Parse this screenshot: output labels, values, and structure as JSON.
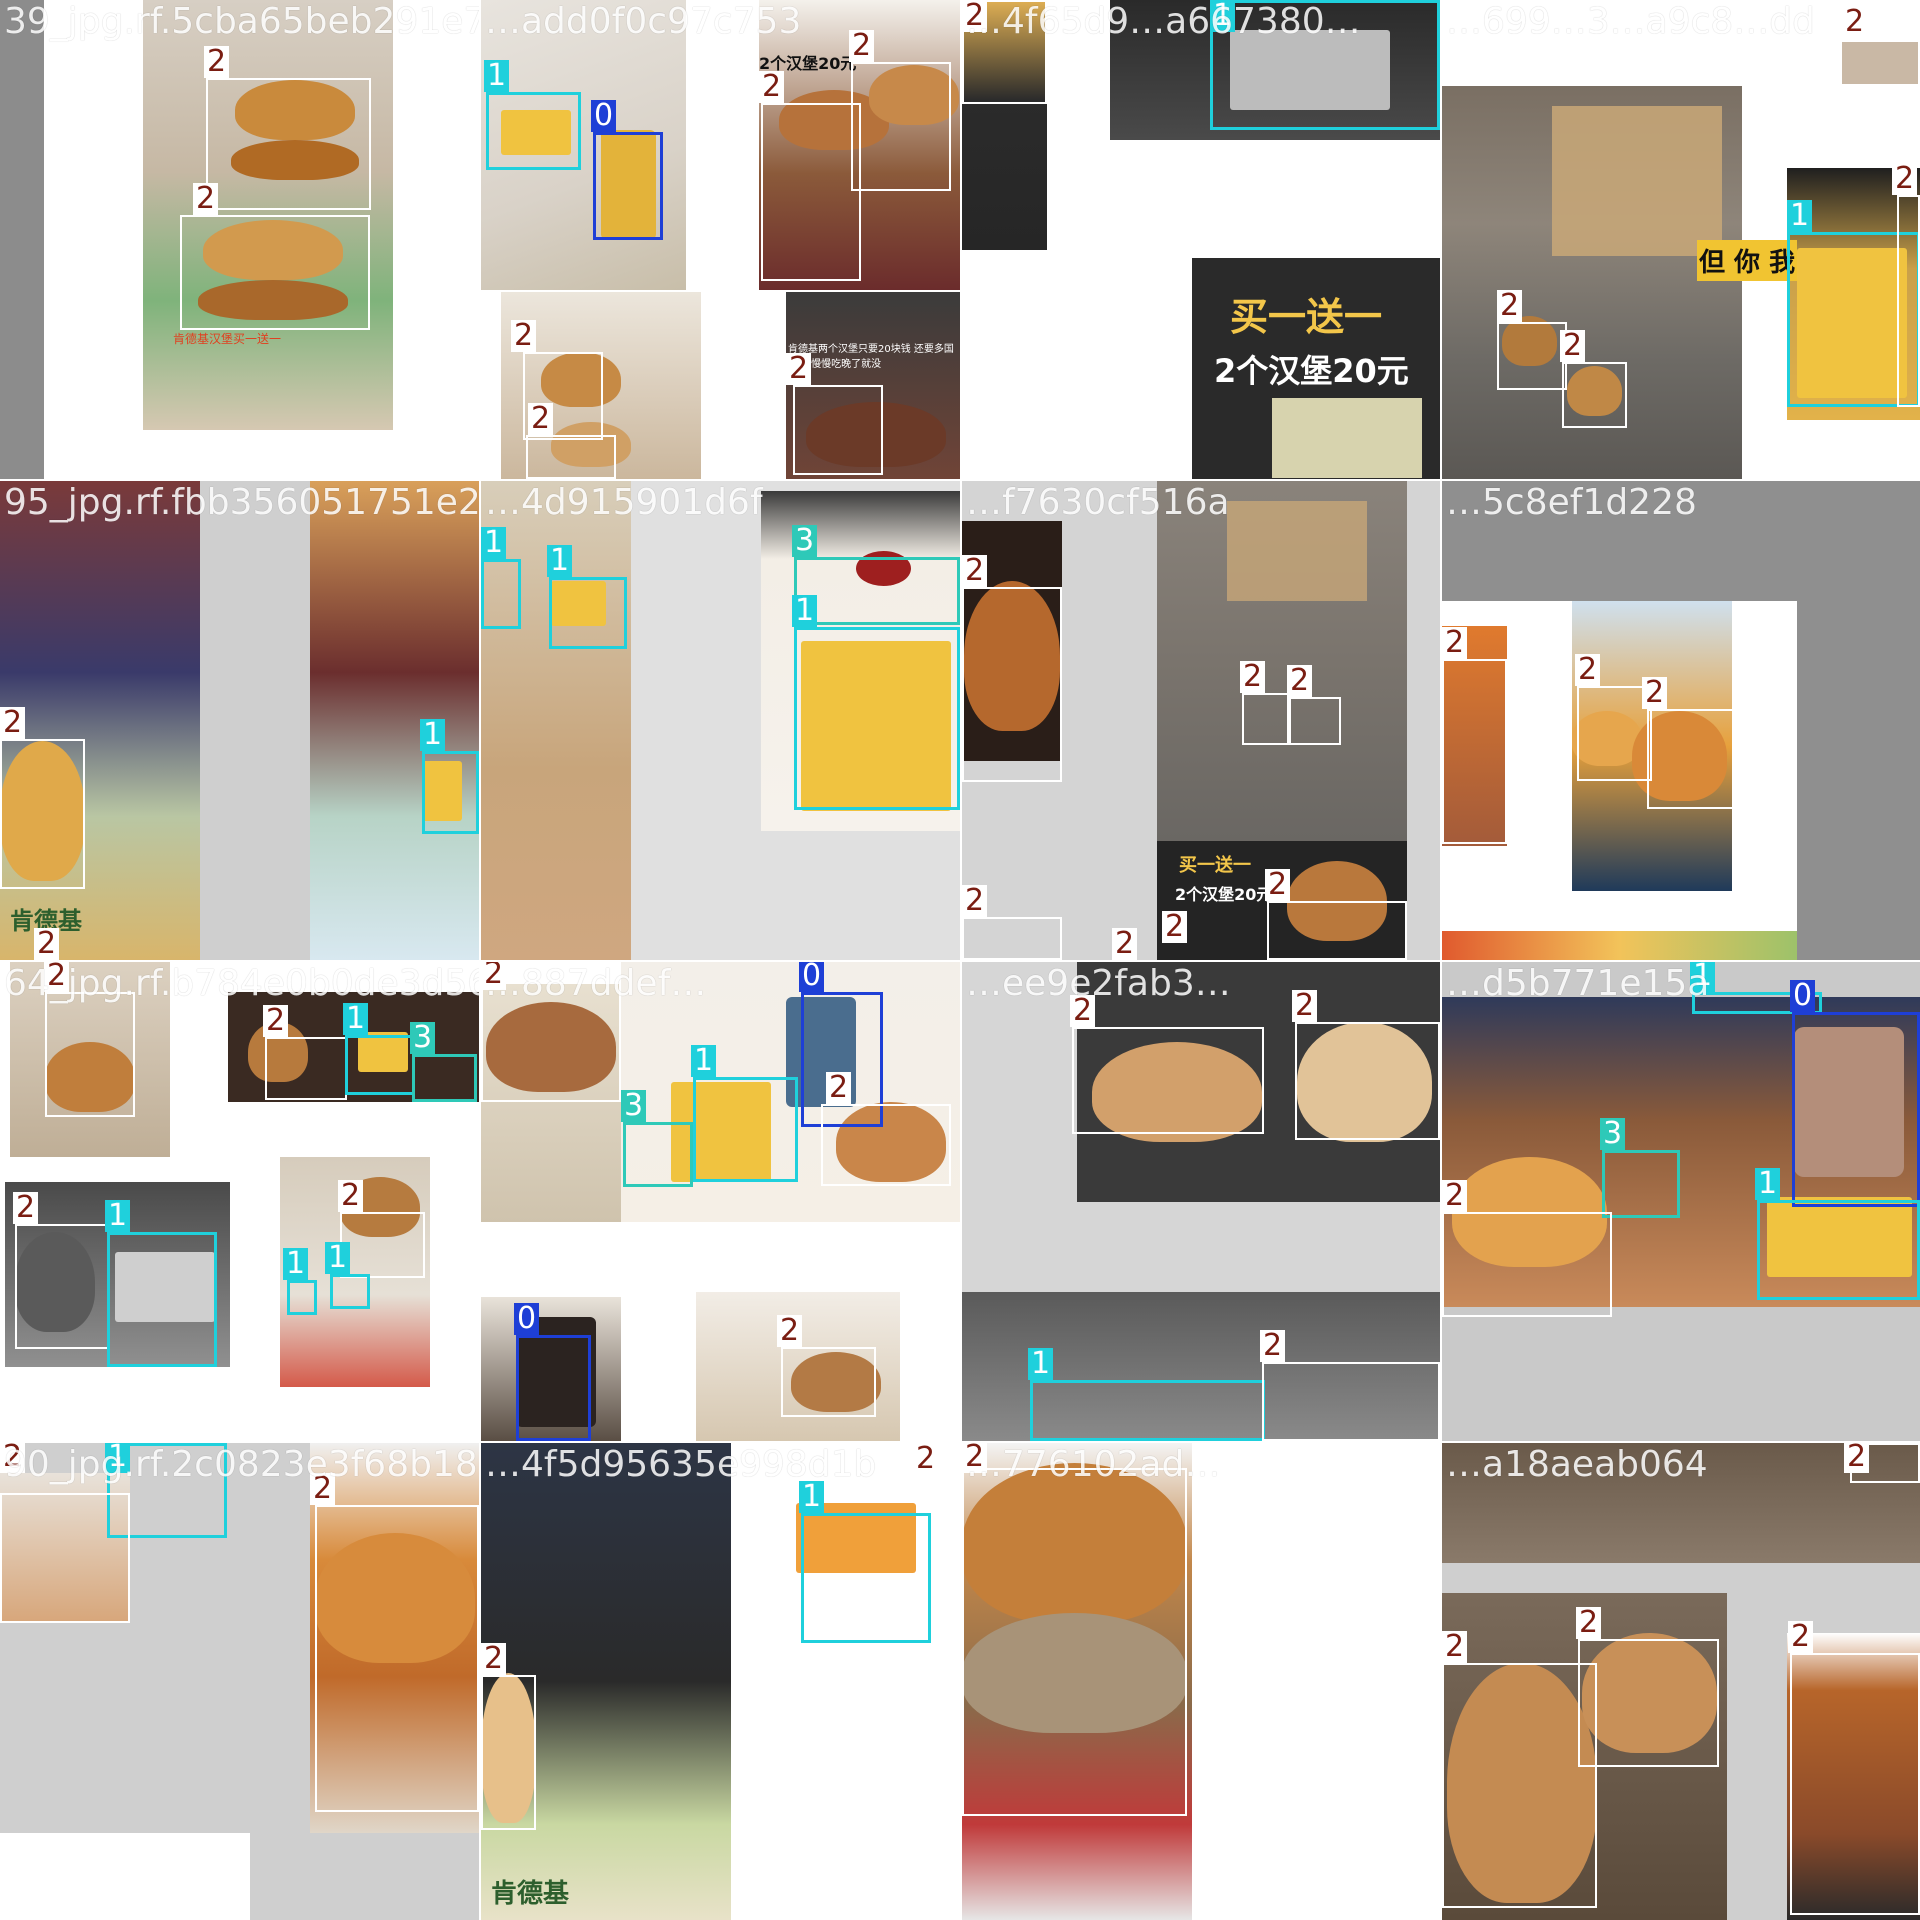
{
  "tiles": [
    {
      "name": "39_jpg.rf.5cba65beb291e72"
    },
    {
      "name": "…add0f0c97c753"
    },
    {
      "name": "…4f65d9…a667380…"
    },
    {
      "name": "…699…3…a9c8…dd"
    },
    {
      "name": "95_jpg.rf.fbb356051751e232"
    },
    {
      "name": "…4d915901d6f"
    },
    {
      "name": "…f7630cf516a"
    },
    {
      "name": "…5c8ef1d228"
    },
    {
      "name": "64_jpg.rf.b784e0b0de3d564"
    },
    {
      "name": "…887ddef…"
    },
    {
      "name": "…ee9e2fab3…"
    },
    {
      "name": "…d5b771e15a"
    },
    {
      "name": "90_jpg.rf.2c0823e3f68b189e"
    },
    {
      "name": "…4f5d95635e998d1b"
    },
    {
      "name": "…776102ad…"
    },
    {
      "name": "…a18aeab064"
    }
  ],
  "captions": {
    "promo_big_1": "买一送一",
    "promo_big_2": "2个汉堡20元",
    "promo_small_1": "买一送一",
    "promo_small_2": "2个汉堡20元",
    "sign_1": "买一送一",
    "sign_2": "2个汉堡20元",
    "kfc_brand": "肯德基",
    "tray_text": "肯德基汉堡买一送一",
    "side_sign": "但 你 我",
    "side_text": "肯德基两个汉堡只要20块钱 还要多国人 你慢慢吃晚了就没"
  },
  "labels": {
    "t1": [
      "2",
      "2"
    ],
    "t2": [
      "1",
      "0",
      "2",
      "2",
      "2",
      "2",
      "2"
    ],
    "t3": [
      "2",
      "1"
    ],
    "t4": [
      "2",
      "2",
      "2",
      "1",
      "2"
    ],
    "t5": [
      "2",
      "1",
      "2"
    ],
    "t6": [
      "1",
      "1",
      "3",
      "1"
    ],
    "t7": [
      "2",
      "2",
      "2",
      "2",
      "2",
      "2",
      "2"
    ],
    "t8": [
      "2",
      "2",
      "2"
    ],
    "t9": [
      "2",
      "2",
      "1",
      "3",
      "2",
      "1",
      "2",
      "1",
      "1"
    ],
    "t10": [
      "2",
      "0",
      "1",
      "2",
      "3",
      "0",
      "2"
    ],
    "t11": [
      "2",
      "2",
      "1",
      "2"
    ],
    "t12": [
      "1",
      "0",
      "3",
      "2",
      "1"
    ],
    "t13": [
      "2",
      "1",
      "2"
    ],
    "t14": [
      "2",
      "1",
      "2"
    ],
    "t15": [
      "2"
    ],
    "t16": [
      "2",
      "2",
      "2",
      "2"
    ]
  },
  "class_colors": {
    "c0": "#1e3fd6",
    "c1": "#1fd0dc",
    "c2": "#ffffff",
    "c3": "#2ec9b8",
    "label_text_c2": "#7a1d12"
  }
}
